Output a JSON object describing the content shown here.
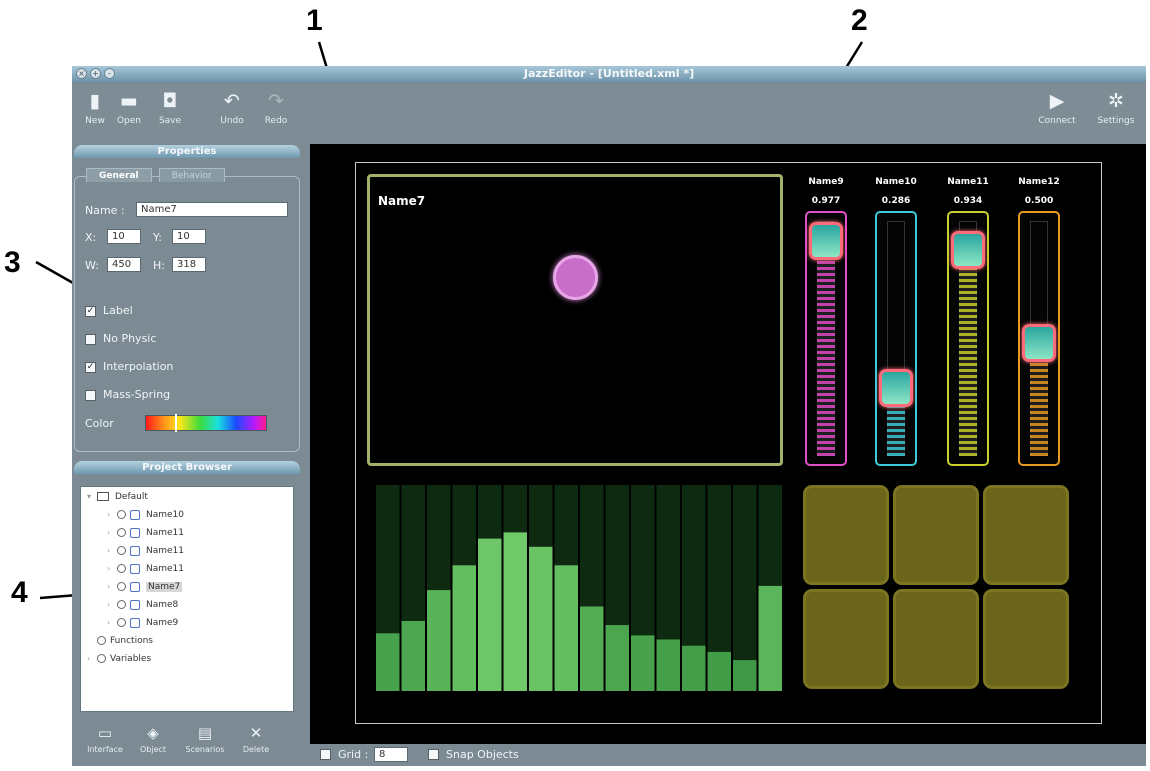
{
  "callouts": [
    "1",
    "2",
    "3",
    "4"
  ],
  "window": {
    "title": "JazzEditor - [Untitled.xml *]"
  },
  "toolbar": {
    "new": "New",
    "open": "Open",
    "save": "Save",
    "undo": "Undo",
    "redo": "Redo",
    "connect": "Connect",
    "settings": "Settings"
  },
  "properties": {
    "title": "Properties",
    "tabs": [
      "General",
      "Behavior"
    ],
    "name_label": "Name :",
    "name_value": "Name7",
    "x_label": "X:",
    "x_value": "10",
    "y_label": "Y:",
    "y_value": "10",
    "w_label": "W:",
    "w_value": "450",
    "h_label": "H:",
    "h_value": "318",
    "checkboxes": [
      {
        "label": "Label",
        "checked": true
      },
      {
        "label": "No Physic",
        "checked": false
      },
      {
        "label": "Interpolation",
        "checked": true
      },
      {
        "label": "Mass-Spring",
        "checked": false
      }
    ],
    "color_label": "Color"
  },
  "project_browser": {
    "title": "Project Browser",
    "root": "Default",
    "items": [
      "Name10",
      "Name11",
      "Name11",
      "Name11",
      "Name7",
      "Name8",
      "Name9"
    ],
    "selected": "Name7",
    "extra": [
      "Functions",
      "Variables"
    ],
    "buttons": [
      "Interface",
      "Object",
      "Scenarios",
      "Delete"
    ]
  },
  "stage": {
    "xy_pad": {
      "name": "Name7",
      "ball_x": 0.5,
      "ball_y": 0.34
    },
    "faders": [
      {
        "name": "Name9",
        "value": "0.977",
        "level": 0.977,
        "color": "#e04ec8"
      },
      {
        "name": "Name10",
        "value": "0.286",
        "level": 0.286,
        "color": "#3ecad6"
      },
      {
        "name": "Name11",
        "value": "0.934",
        "level": 0.934,
        "color": "#c9cf2c"
      },
      {
        "name": "Name12",
        "value": "0.500",
        "level": 0.5,
        "color": "#e89a22"
      }
    ],
    "multislider_levels": [
      0.28,
      0.34,
      0.49,
      0.61,
      0.74,
      0.77,
      0.7,
      0.61,
      0.41,
      0.32,
      0.27,
      0.25,
      0.22,
      0.19,
      0.15,
      0.51
    ],
    "pad_count": 6,
    "pad_color": "#6a651a"
  },
  "statusbar": {
    "grid_label": "Grid :",
    "grid_value": "8",
    "snap_label": "Snap Objects"
  }
}
